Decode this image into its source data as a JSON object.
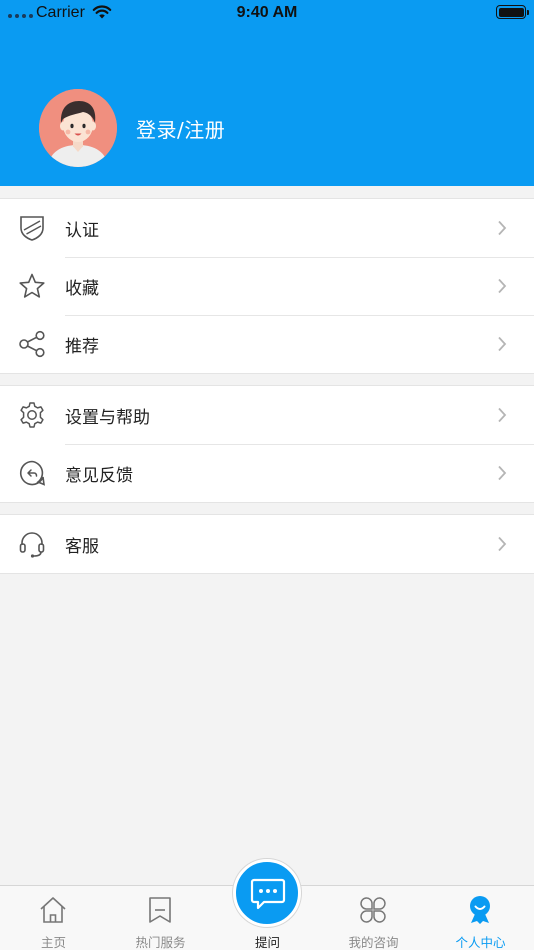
{
  "status_bar": {
    "carrier": "Carrier",
    "time": "9:40 AM"
  },
  "profile": {
    "login_label": "登录/注册"
  },
  "menu_groups": [
    {
      "items": [
        {
          "label": "认证",
          "icon": "shield-icon"
        },
        {
          "label": "收藏",
          "icon": "star-icon"
        },
        {
          "label": "推荐",
          "icon": "share-icon"
        }
      ]
    },
    {
      "items": [
        {
          "label": "设置与帮助",
          "icon": "gear-icon"
        },
        {
          "label": "意见反馈",
          "icon": "feedback-icon"
        }
      ]
    },
    {
      "items": [
        {
          "label": "客服",
          "icon": "headset-icon"
        }
      ]
    }
  ],
  "tab_bar": {
    "tabs": [
      {
        "label": "主页",
        "icon": "home-icon"
      },
      {
        "label": "热门服务",
        "icon": "bookmark-icon"
      },
      {
        "label": "提问",
        "icon": "chat-bubble-icon"
      },
      {
        "label": "我的咨询",
        "icon": "four-petal-icon"
      },
      {
        "label": "个人中心",
        "icon": "person-badge-icon",
        "active": true
      }
    ]
  },
  "colors": {
    "accent": "#0a9bf2",
    "background": "#f3f3f3",
    "avatar_bg": "#f08f7f"
  }
}
